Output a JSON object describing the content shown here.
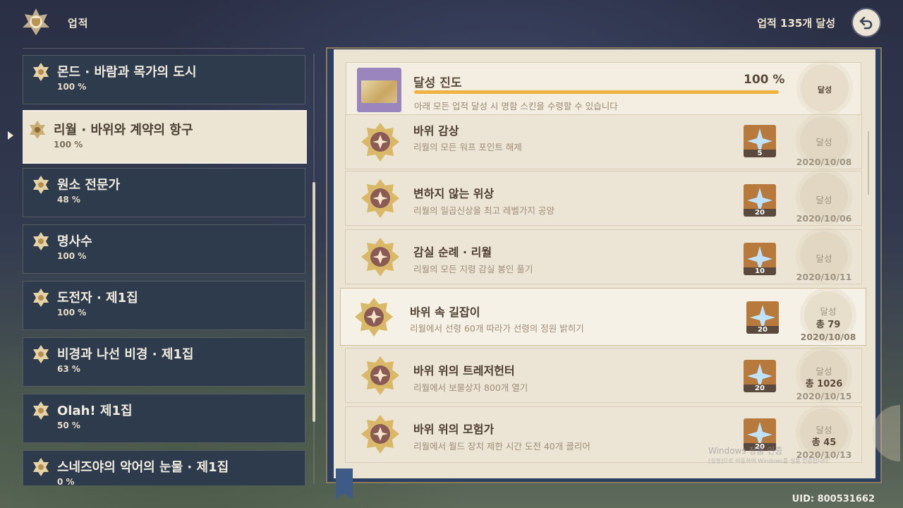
{
  "header": {
    "title": "업적",
    "completed": "업적 135개 달성"
  },
  "categories": [
    {
      "name": "몬드 · 바람과 목가의 도시",
      "percent": "100 %"
    },
    {
      "name": "리월 · 바위와 계약의 항구",
      "percent": "100 %",
      "selected": true
    },
    {
      "name": "원소 전문가",
      "percent": "48 %"
    },
    {
      "name": "명사수",
      "percent": "100 %"
    },
    {
      "name": "도전자 · 제1집",
      "percent": "100 %"
    },
    {
      "name": "비경과 나선 비경 · 제1집",
      "percent": "63 %"
    },
    {
      "name": "Olah! 제1집",
      "percent": "50 %"
    },
    {
      "name": "스네즈야의 악어의 눈물 · 제1집",
      "percent": "0 %"
    }
  ],
  "progress": {
    "title": "달성 진도",
    "percent": "100 %",
    "progress_fraction": 1.0,
    "description": "아래 모든 업적 달성 시 명함 스킨을 수령할 수 있습니다",
    "stamp": "달성"
  },
  "achievements": [
    {
      "name": "바위 감상",
      "desc": "리월의 모든 워프 포인트 해제",
      "reward": "5",
      "status": "달성",
      "total": "",
      "date": "2020/10/08"
    },
    {
      "name": "변하지 않는 위상",
      "desc": "리월의 일곱신상을 최고 레벨가지 공양",
      "reward": "20",
      "status": "달성",
      "total": "",
      "date": "2020/10/06"
    },
    {
      "name": "감실 순례 · 리월",
      "desc": "리월의 모든 지령 감실 봉인 풀기",
      "reward": "10",
      "status": "달성",
      "total": "",
      "date": "2020/10/11"
    },
    {
      "name": "바위 속 길잡이",
      "desc": "리월에서 선령 60개 따라가 선령의 정원 밝히기",
      "reward": "20",
      "status": "달성",
      "total": "총 79",
      "date": "2020/10/08"
    },
    {
      "name": "바위 위의 트레저헌터",
      "desc": "리월에서 보물상자 800개 열기",
      "reward": "20",
      "status": "달성",
      "total": "총 1026",
      "date": "2020/10/15"
    },
    {
      "name": "바위 위의 모험가",
      "desc": "리월에서 월드 장치 제한 시간 도전 40개 클리어",
      "reward": "20",
      "status": "달성",
      "total": "총 45",
      "date": "2020/10/13"
    }
  ],
  "watermark": {
    "line1": "Windows 정품 인증",
    "line2": "[설정]으로 이동하여 Windows를 정품 인증합니다."
  },
  "uid": "UID: 800531662",
  "colors": {
    "accent": "#f1b33f",
    "panel": "#2e3b4d",
    "page": "#ece4d3"
  }
}
